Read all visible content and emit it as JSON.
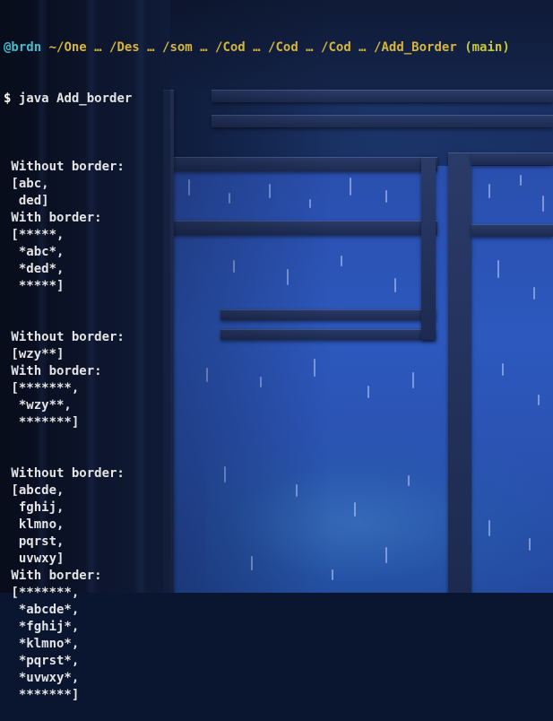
{
  "prompt": {
    "user": "@brdn",
    "path": "~/One … /Des … /som … /Cod … /Cod … /Cod … /Add_Border",
    "branch": "(main)",
    "symbol": "$",
    "command": "java Add_border"
  },
  "output": [
    {
      "without_label": " Without border:",
      "without_lines": [
        " [abc,",
        "  ded]"
      ],
      "with_label": " With border:",
      "with_lines": [
        " [*****,",
        "  *abc*,",
        "  *ded*,",
        "  *****]"
      ]
    },
    {
      "without_label": " Without border:",
      "without_lines": [
        " [wzy**]"
      ],
      "with_label": " With border:",
      "with_lines": [
        " [*******,",
        "  *wzy**,",
        "  *******]"
      ]
    },
    {
      "without_label": " Without border:",
      "without_lines": [
        " [abcde,",
        "  fghij,",
        "  klmno,",
        "  pqrst,",
        "  uvwxy]"
      ],
      "with_label": " With border:",
      "with_lines": [
        " [*******,",
        "  *abcde*,",
        "  *fghij*,",
        "  *klmno*,",
        "  *pqrst*,",
        "  *uvwxy*,",
        "  *******]"
      ]
    }
  ]
}
